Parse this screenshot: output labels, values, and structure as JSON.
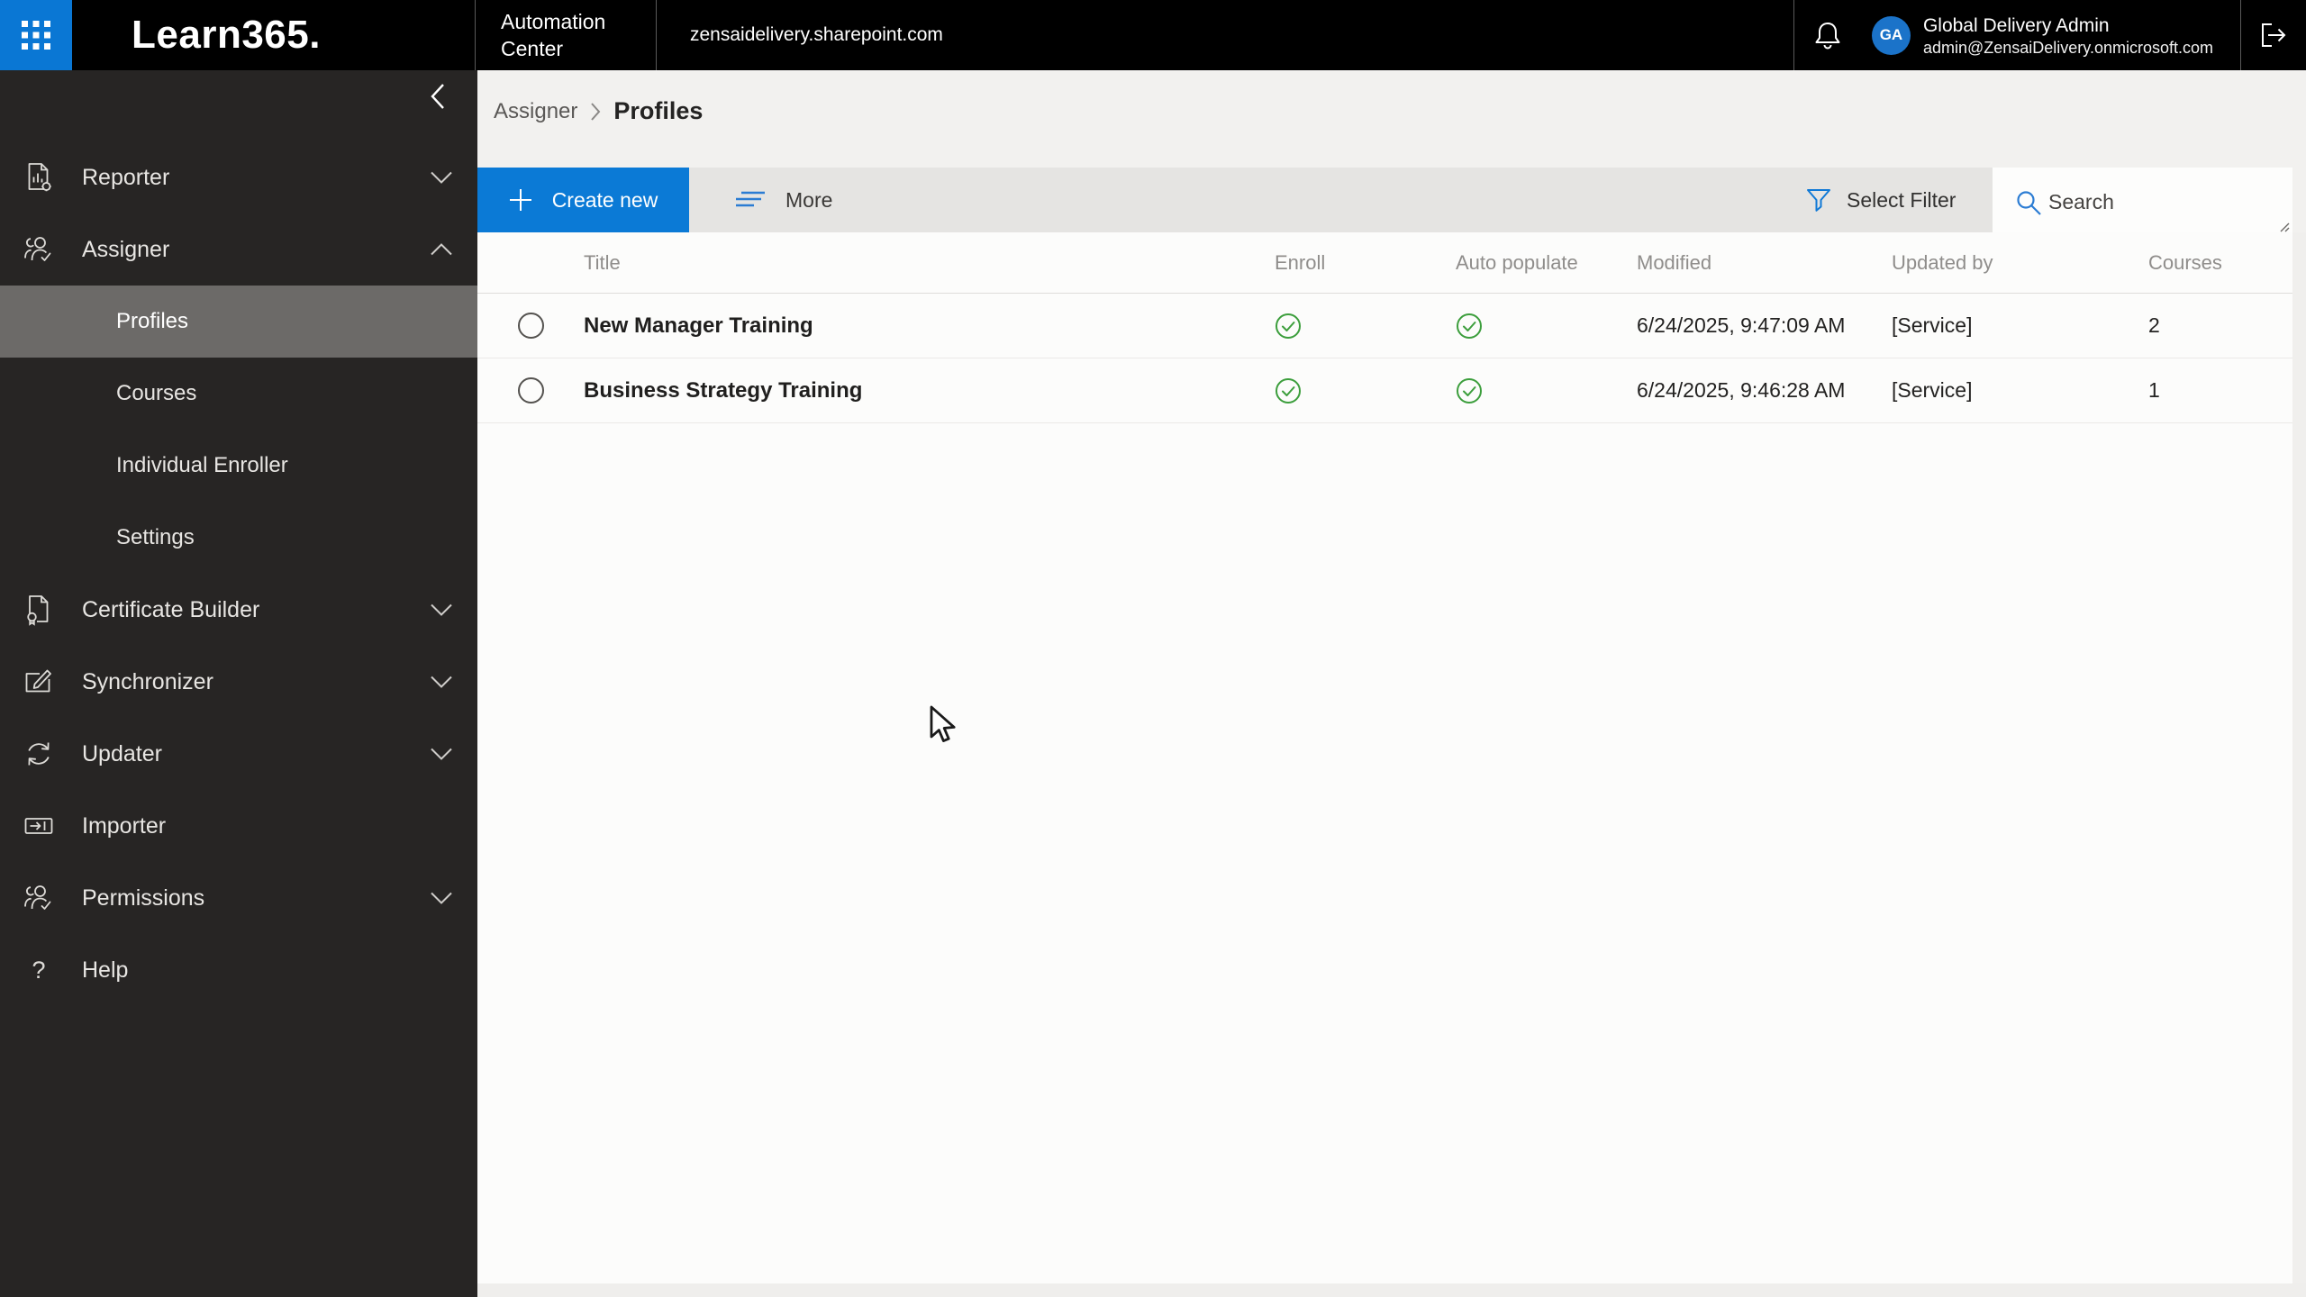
{
  "colors": {
    "accent": "#0078d4",
    "green": "#3c9e3c",
    "topbar": "#000000",
    "sidebar_bg": "#272524",
    "selected_item_bg": "#6c6a68"
  },
  "top_bar": {
    "logo": "Learn365.",
    "module": {
      "line1": "Automation",
      "line2": "Center"
    },
    "site_url": "zensaidelivery.sharepoint.com",
    "user": {
      "initials": "GA",
      "name": "Global Delivery Admin",
      "email": "admin@ZensaiDelivery.onmicrosoft.com"
    }
  },
  "sidebar": {
    "items": [
      {
        "label": "Reporter",
        "expanded": false
      },
      {
        "label": "Assigner",
        "expanded": true
      },
      {
        "label": "Profiles",
        "selected": true
      },
      {
        "label": "Courses",
        "selected": false
      },
      {
        "label": "Individual Enroller",
        "selected": false
      },
      {
        "label": "Settings",
        "selected": false
      },
      {
        "label": "Certificate Builder",
        "expanded": false
      },
      {
        "label": "Synchronizer",
        "expanded": false
      },
      {
        "label": "Updater",
        "expanded": false
      },
      {
        "label": "Importer"
      },
      {
        "label": "Permissions",
        "expanded": false
      },
      {
        "label": "Help"
      }
    ]
  },
  "breadcrumb": {
    "parent": "Assigner",
    "current": "Profiles"
  },
  "toolbar": {
    "create_new": "Create new",
    "more": "More",
    "select_filter": "Select Filter",
    "search_placeholder": "Search"
  },
  "table": {
    "columns": {
      "title": "Title",
      "enroll": "Enroll",
      "auto_populate": "Auto populate",
      "modified": "Modified",
      "updated_by": "Updated by",
      "courses": "Courses"
    },
    "rows": [
      {
        "title": "New Manager Training",
        "enroll": true,
        "auto_populate": true,
        "modified": "6/24/2025, 9:47:09 AM",
        "updated_by": "[Service]",
        "courses": "2"
      },
      {
        "title": "Business Strategy Training",
        "enroll": true,
        "auto_populate": true,
        "modified": "6/24/2025, 9:46:28 AM",
        "updated_by": "[Service]",
        "courses": "1"
      }
    ]
  }
}
